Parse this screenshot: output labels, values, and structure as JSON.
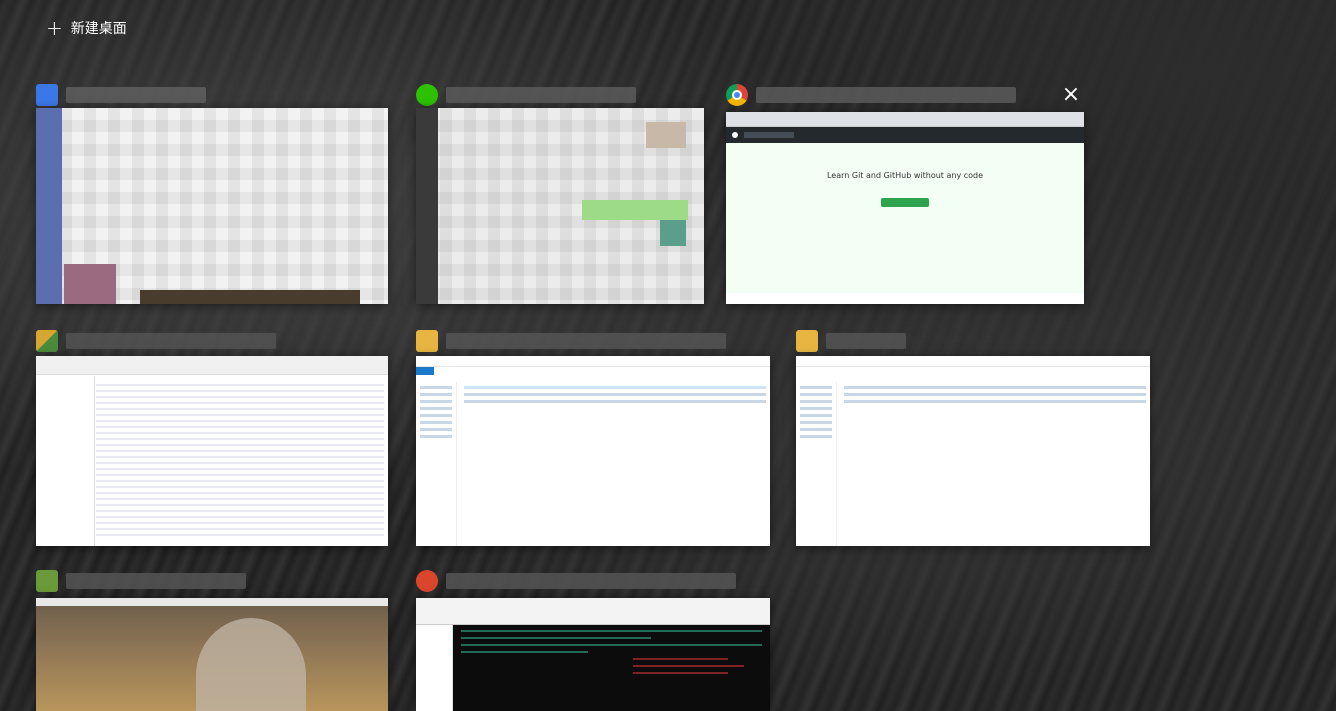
{
  "new_desktop": {
    "label": "新建桌面",
    "icon": "plus-icon"
  },
  "windows": [
    {
      "id": "w1",
      "app_icon": "blurred-app-icon"
    },
    {
      "id": "w2",
      "app_icon": "wechat-icon"
    },
    {
      "id": "w3",
      "app_icon": "chrome-icon",
      "page_heading": "Learn Git and GitHub without any code",
      "close": "×"
    },
    {
      "id": "w4",
      "app_icon": "csv-editor-icon"
    },
    {
      "id": "w5",
      "app_icon": "folder-icon"
    },
    {
      "id": "w6",
      "app_icon": "folder-icon"
    },
    {
      "id": "w7",
      "app_icon": "terminal-icon"
    },
    {
      "id": "w8",
      "app_icon": "ssh-client-icon"
    }
  ],
  "colors": {
    "wechat": "#2dc100",
    "chrome_red": "#db4437",
    "github_green": "#2ea44f",
    "folder": "#e8b640"
  }
}
